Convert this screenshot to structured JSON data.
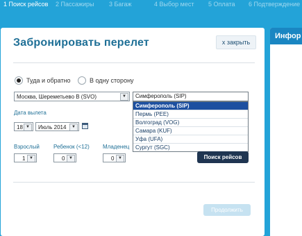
{
  "steps": [
    {
      "label": "1 Поиск рейсов"
    },
    {
      "label": "2 Пассажиры"
    },
    {
      "label": "3 Багаж"
    },
    {
      "label": "4 Выбор мест"
    },
    {
      "label": "5 Оплата"
    },
    {
      "label": "6 Подтверждение"
    }
  ],
  "panel": {
    "title": "Забронировать перелет",
    "close_label": "x закрыть"
  },
  "side_panel": {
    "title": "Инфор"
  },
  "trip_type": {
    "round_trip_label": "Туда и обратно",
    "one_way_label": "В одну сторону",
    "selected": "round_trip"
  },
  "origin": {
    "value": "Москва, Шереметьево B (SVO)"
  },
  "destination": {
    "value": "Симферополь (SIP)",
    "options": [
      "Симферополь (SIP)",
      "Пермь (PEE)",
      "Волгоград (VOG)",
      "Самара (KUF)",
      "Уфа (UFA)",
      "Сургут (SGC)"
    ],
    "highlighted_index": 0
  },
  "departure": {
    "label": "Дата вылета",
    "day": "18",
    "month": "Июль 2014"
  },
  "passengers": {
    "adults_label": "Взрослый",
    "adults_value": "1",
    "children_label": "Ребенок (<12)",
    "children_value": "0",
    "infants_label": "Младенец",
    "infants_value": "0"
  },
  "actions": {
    "search_label": "Поиск рейсов",
    "continue_label": "Продолжить"
  },
  "colors": {
    "background": "#23a3d8",
    "title": "#1e6f96",
    "search_button": "#1f3551",
    "dropdown_highlight": "#1c4fa0"
  }
}
